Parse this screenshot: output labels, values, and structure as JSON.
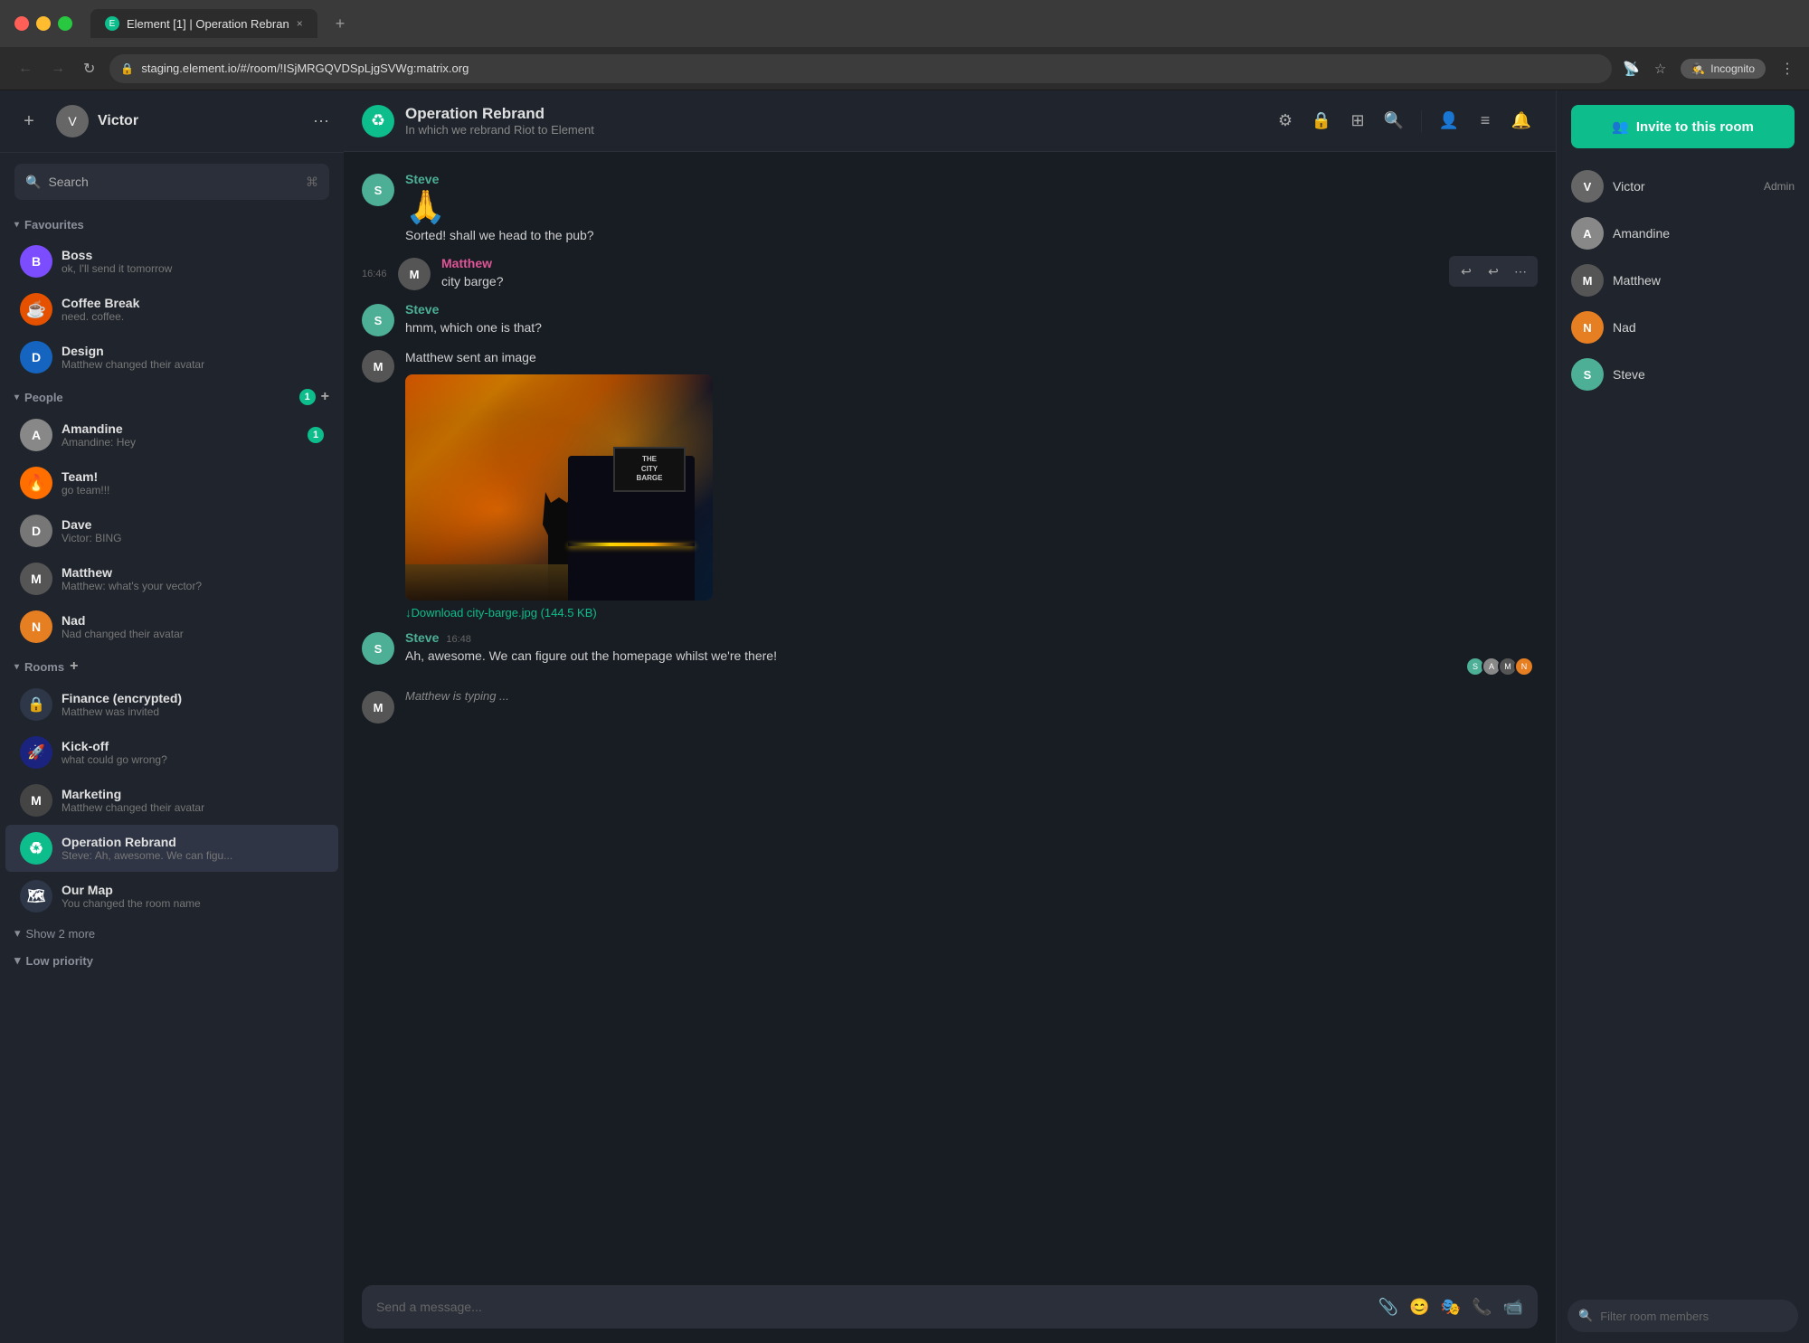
{
  "browser": {
    "tab_title": "Element [1] | Operation Rebran",
    "tab_close": "×",
    "new_tab": "+",
    "nav_back": "←",
    "nav_forward": "→",
    "nav_reload": "↻",
    "address": "staging.element.io/#/room/!ISjMRGQVDSpLjgSVWg:matrix.org",
    "incognito_label": "Incognito",
    "nav_more": "⋮"
  },
  "sidebar": {
    "username": "Victor",
    "search_placeholder": "Search",
    "add_label": "+",
    "sections": {
      "favourites": {
        "label": "Favourites",
        "items": [
          {
            "name": "Boss",
            "preview": "ok, I'll send it tomorrow",
            "avatar_text": "B",
            "avatar_class": "av-boss"
          },
          {
            "name": "Coffee Break",
            "preview": "need. coffee.",
            "avatar_text": "☕",
            "avatar_class": "av-coffee"
          },
          {
            "name": "Design",
            "preview": "Matthew changed their avatar",
            "avatar_text": "D",
            "avatar_class": "av-design"
          }
        ]
      },
      "people": {
        "label": "People",
        "badge": "1",
        "items": [
          {
            "name": "Amandine",
            "preview": "Amandine: Hey",
            "badge": "1",
            "avatar_text": "A",
            "avatar_class": "av-amandine"
          },
          {
            "name": "Team!",
            "preview": "go team!!!",
            "avatar_text": "🔥",
            "avatar_class": "av-team"
          },
          {
            "name": "Dave",
            "preview": "Victor: BING",
            "avatar_text": "D",
            "avatar_class": "av-dave"
          },
          {
            "name": "Matthew",
            "preview": "Matthew: what's your vector?",
            "avatar_text": "M",
            "avatar_class": "av-matthew"
          },
          {
            "name": "Nad",
            "preview": "Nad changed their avatar",
            "avatar_text": "N",
            "avatar_class": "av-nad"
          }
        ]
      },
      "rooms": {
        "label": "Rooms",
        "items": [
          {
            "name": "Finance (encrypted)",
            "preview": "Matthew was invited",
            "avatar_text": "🔒",
            "avatar_class": "av-finance"
          },
          {
            "name": "Kick-off",
            "preview": "what could go wrong?",
            "avatar_text": "🚀",
            "avatar_class": "av-kickoff"
          },
          {
            "name": "Marketing",
            "preview": "Matthew changed their avatar",
            "avatar_text": "M",
            "avatar_class": "av-marketing"
          },
          {
            "name": "Operation Rebrand",
            "preview": "Steve: Ah, awesome. We can figu...",
            "avatar_text": "♻",
            "avatar_class": "av-rebrand",
            "active": true
          },
          {
            "name": "Our Map",
            "preview": "You changed the room name",
            "avatar_text": "🗺",
            "avatar_class": "av-ourmap"
          }
        ]
      }
    },
    "show_more_label": "Show 2 more",
    "low_priority_label": "Low priority"
  },
  "chat": {
    "room_name": "Operation Rebrand",
    "room_topic": "In which we rebrand Riot to Element",
    "messages": [
      {
        "id": "msg1",
        "author": "Steve",
        "author_class": "steve",
        "avatar_text": "S",
        "content_type": "text_emoji",
        "emoji": "🙏",
        "text": "Sorted! shall we head to the pub?"
      },
      {
        "id": "msg2",
        "author": "Matthew",
        "author_class": "matthew",
        "avatar_text": "M",
        "time": "16:46",
        "content_type": "text",
        "text": "city barge?",
        "has_hover_actions": true
      },
      {
        "id": "msg3",
        "author": "Steve",
        "author_class": "steve",
        "avatar_text": "S",
        "content_type": "text",
        "text": "hmm, which one is that?"
      },
      {
        "id": "msg4",
        "author": "Matthew",
        "author_class": "matthew",
        "avatar_text": "M",
        "content_type": "image",
        "caption": "Matthew sent an image",
        "image_alt": "The City Barge pub",
        "sign_line1": "THE",
        "sign_line2": "CITY",
        "sign_line3": "BARGE",
        "download_label": "↓Download city-barge.jpg (144.5 KB)"
      },
      {
        "id": "msg5",
        "author": "Steve",
        "author_class": "steve",
        "avatar_text": "S",
        "time": "16:48",
        "content_type": "text",
        "text": "Ah, awesome. We can figure out the homepage whilst we're there!",
        "has_reactions": true
      },
      {
        "id": "msg6",
        "content_type": "typing",
        "text": "Matthew is typing ..."
      }
    ],
    "input_placeholder": "Send a message...",
    "hover_actions": {
      "react": "↩",
      "reply": "↩",
      "more": "⋯"
    }
  },
  "right_panel": {
    "invite_btn_label": "Invite to this room",
    "members": [
      {
        "name": "Victor",
        "role": "Admin",
        "avatar_text": "V",
        "avatar_class": "av-victor-main"
      },
      {
        "name": "Amandine",
        "role": "",
        "avatar_text": "A",
        "avatar_class": "av-amandine"
      },
      {
        "name": "Matthew",
        "role": "",
        "avatar_text": "M",
        "avatar_class": "av-matthew"
      },
      {
        "name": "Nad",
        "role": "",
        "avatar_text": "N",
        "avatar_class": "av-nad"
      },
      {
        "name": "Steve",
        "role": "",
        "avatar_text": "S",
        "avatar_class": "av-kickoff"
      }
    ],
    "filter_placeholder": "Filter room members"
  }
}
